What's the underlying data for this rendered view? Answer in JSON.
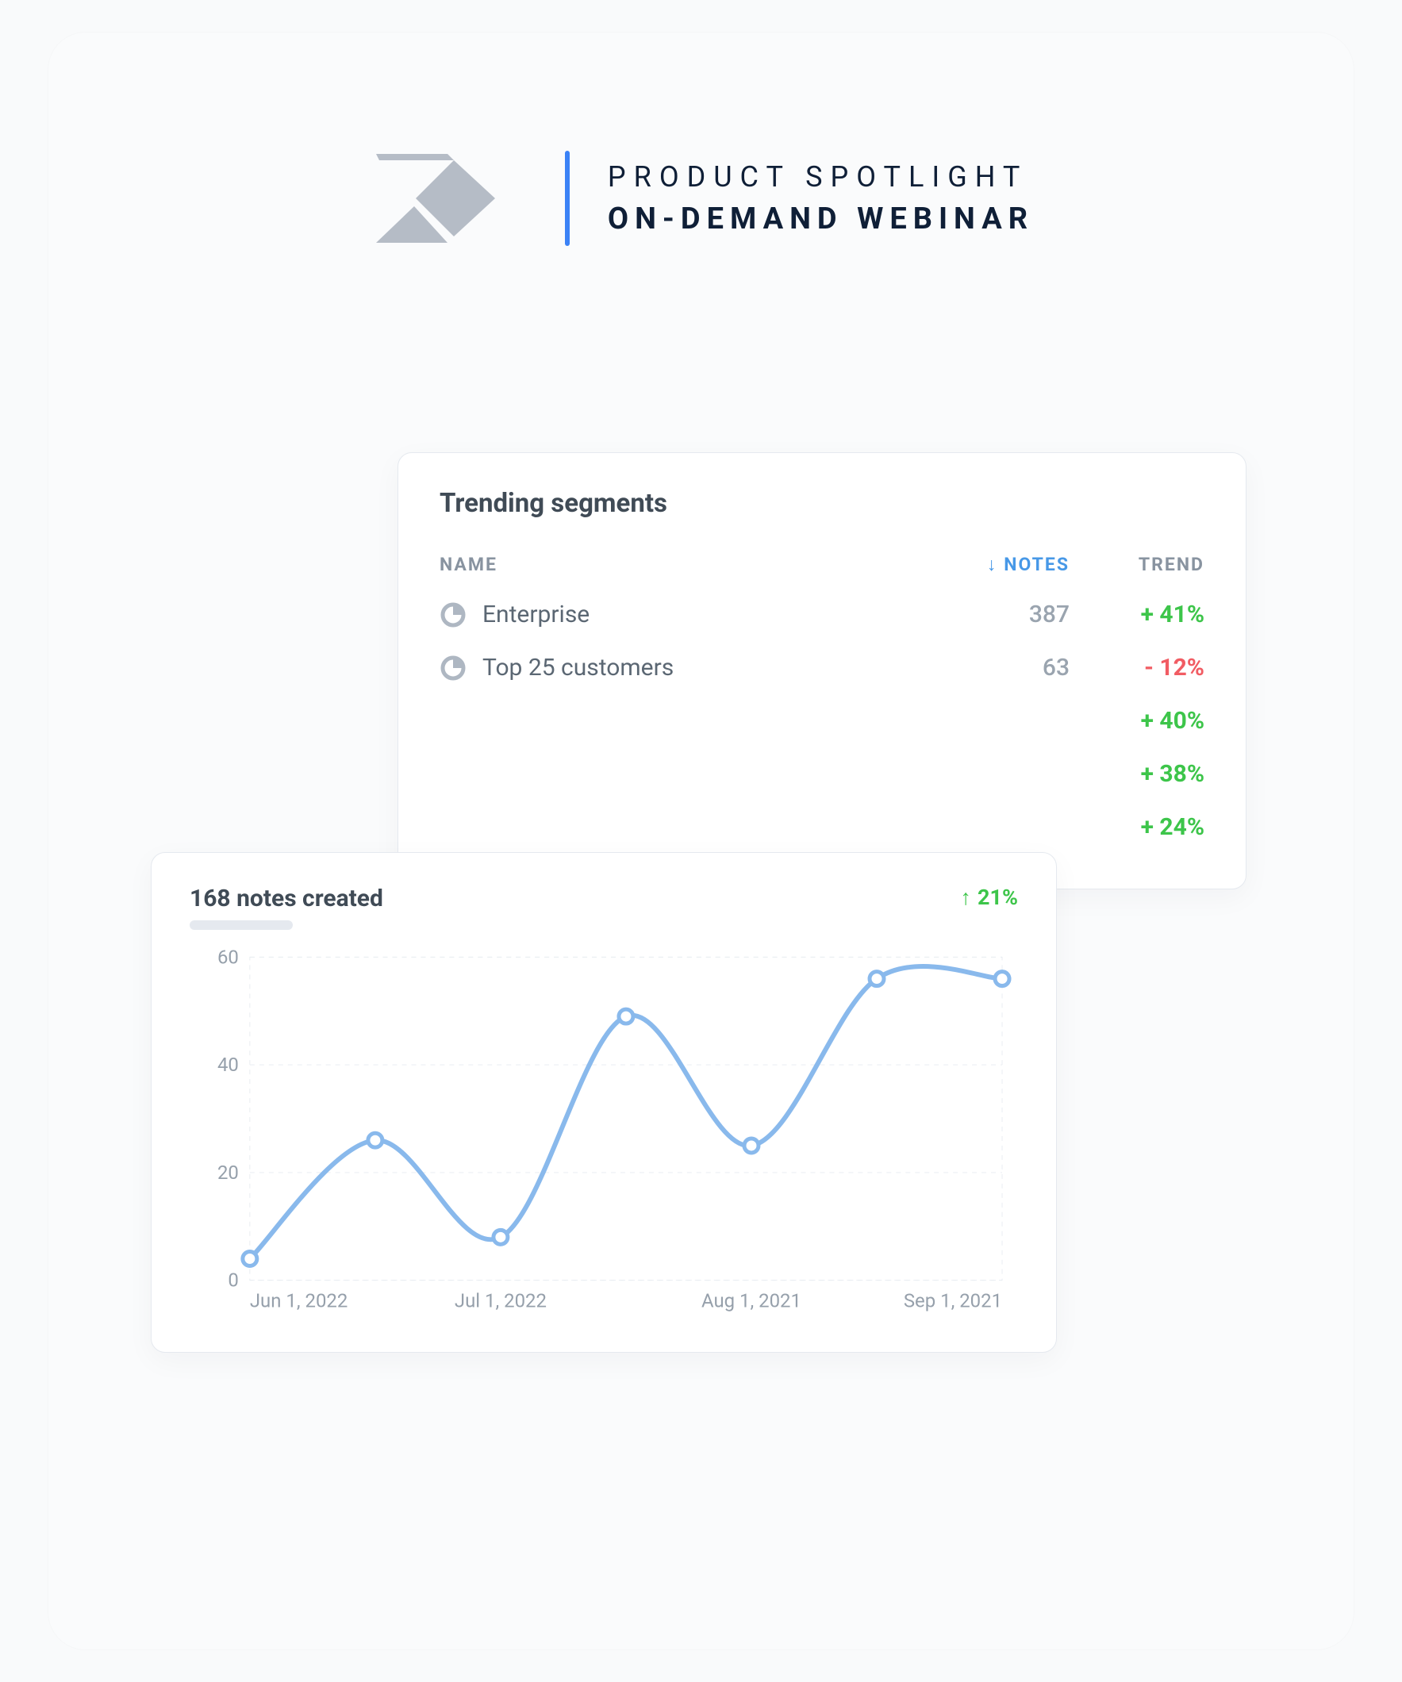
{
  "header": {
    "eyebrow": "PRODUCT SPOTLIGHT",
    "headline": "ON-DEMAND WEBINAR"
  },
  "segments": {
    "title": "Trending segments",
    "columns": {
      "name": "NAME",
      "notes": "NOTES",
      "trend": "TREND"
    },
    "rows": [
      {
        "icon": "pie-icon",
        "name": "Enterprise",
        "notes": "387",
        "trend": "+ 41%",
        "dir": "up"
      },
      {
        "icon": "pie-icon",
        "name": "Top 25 customers",
        "notes": "63",
        "trend": "- 12%",
        "dir": "down"
      },
      {
        "icon": "",
        "name": "",
        "notes": "",
        "trend": "+ 40%",
        "dir": "up"
      },
      {
        "icon": "",
        "name": "",
        "notes": "",
        "trend": "+ 38%",
        "dir": "up"
      },
      {
        "icon": "",
        "name": "",
        "notes": "",
        "trend": "+ 24%",
        "dir": "up"
      }
    ]
  },
  "chart_card": {
    "title": "168 notes created",
    "delta": "21%"
  },
  "chart_data": {
    "type": "line",
    "title": "168 notes created",
    "xlabel": "",
    "ylabel": "",
    "ylim": [
      0,
      60
    ],
    "yticks": [
      0,
      20,
      40,
      60
    ],
    "categories": [
      "Jun 1, 2022",
      "Jul 1, 2022",
      "Aug 1, 2021",
      "Sep 1, 2021"
    ],
    "series": [
      {
        "name": "Notes created",
        "x": [
          0,
          1,
          2,
          3,
          4,
          5,
          6
        ],
        "values": [
          4,
          26,
          8,
          49,
          25,
          56,
          56
        ]
      }
    ]
  },
  "colors": {
    "accent": "#3b82f6",
    "line": "#89b9ec",
    "up": "#3dc54a",
    "down": "#f15c63",
    "muted": "#96a0ab"
  }
}
